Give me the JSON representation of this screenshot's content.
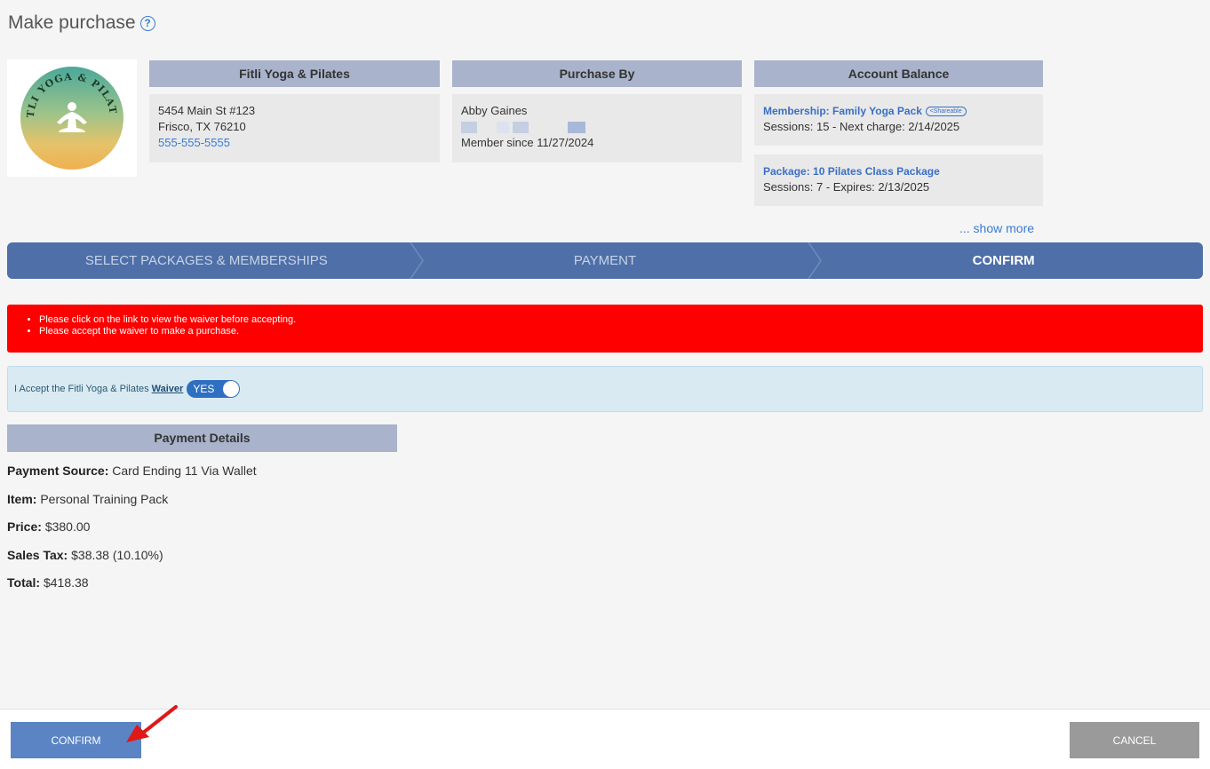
{
  "header": {
    "title": "Make purchase",
    "help_icon": "?"
  },
  "business": {
    "heading": "Fitli Yoga & Pilates",
    "address_line1": "5454 Main St #123",
    "address_line2": "Frisco, TX 76210",
    "phone": "555-555-5555",
    "logo_text": "FITLI YOGA & PILATES"
  },
  "purchaser": {
    "heading": "Purchase By",
    "name": "Abby Gaines",
    "member_since": "Member since 11/27/2024"
  },
  "balance": {
    "heading": "Account Balance",
    "items": [
      {
        "title": "Membership: Family Yoga Pack",
        "badge": "Shareable",
        "detail": "Sessions: 15 -  Next charge: 2/14/2025"
      },
      {
        "title": "Package: 10 Pilates Class Package",
        "detail": "Sessions: 7 -  Expires: 2/13/2025"
      }
    ],
    "show_more": "... show more"
  },
  "steps": [
    "SELECT PACKAGES & MEMBERSHIPS",
    "PAYMENT",
    "CONFIRM"
  ],
  "errors": [
    "Please click on the link to view the waiver before accepting.",
    "Please accept the waiver to make a purchase."
  ],
  "waiver": {
    "text": "I Accept the Fitli Yoga & Pilates",
    "link": "Waiver",
    "toggle": "YES"
  },
  "payment": {
    "heading": "Payment Details",
    "source_label": "Payment Source:",
    "source_value": "Card Ending 11 Via Wallet",
    "item_label": "Item:",
    "item_value": "Personal Training Pack",
    "price_label": "Price:",
    "price_value": "$380.00",
    "tax_label": "Sales Tax:",
    "tax_value": "$38.38 (10.10%)",
    "total_label": "Total:",
    "total_value": "$418.38"
  },
  "footer": {
    "confirm": "CONFIRM",
    "cancel": "CANCEL"
  },
  "colors": {
    "accent": "#4e6fa8",
    "error": "#ff0000",
    "header_bg": "#a9b3cb",
    "link": "#3a7bd5"
  }
}
